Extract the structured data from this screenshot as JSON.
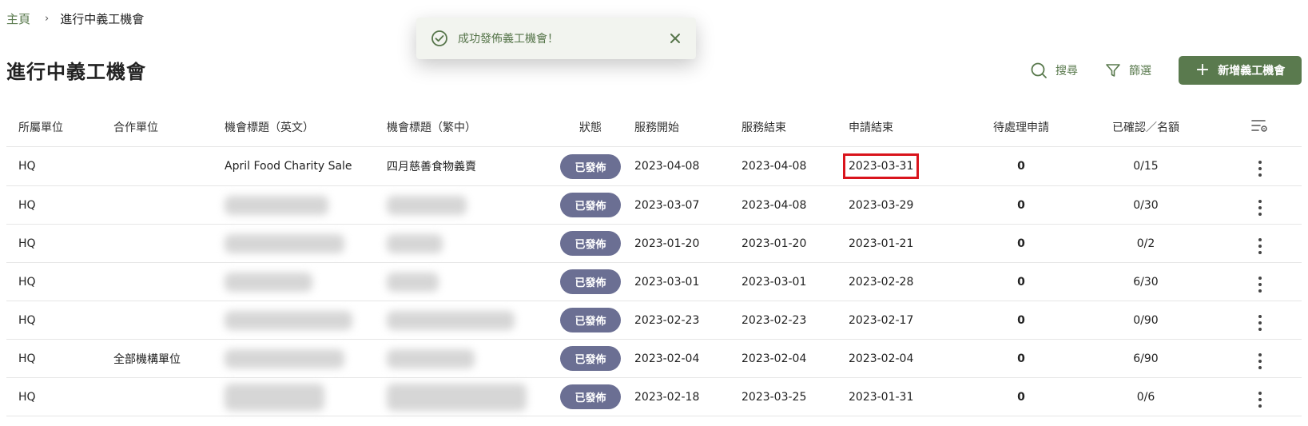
{
  "breadcrumb": {
    "home": "主頁",
    "separator": "›",
    "current": "進行中義工機會"
  },
  "page_title": "進行中義工機會",
  "toast": {
    "message": "成功發佈義工機會！",
    "icon": "check-circle-icon",
    "close_icon": "close-icon"
  },
  "actions": {
    "search_label": "搜尋",
    "filter_label": "篩選",
    "add_label": "新增義工機會",
    "add_symbol": "+"
  },
  "colors": {
    "brand_green": "#5a7a4e",
    "badge": "#6b6f93",
    "highlight": "#d9141c",
    "toast_bg": "#f2f4ef"
  },
  "table": {
    "headers": [
      "所屬單位",
      "合作單位",
      "機會標題（英文）",
      "機會標題（繁中）",
      "狀態",
      "服務開始",
      "服務結束",
      "申請結束",
      "待處理申請",
      "已確認／名額"
    ],
    "rows": [
      {
        "unit": "HQ",
        "partner": "",
        "title_en": "April Food Charity Sale",
        "title_zh": "四月慈善食物義賣",
        "status": "已發佈",
        "start": "2023-04-08",
        "end": "2023-04-08",
        "apply_end": "2023-03-31",
        "pending": "0",
        "confirmed": "0/15"
      },
      {
        "unit": "HQ",
        "partner": "",
        "title_en": "",
        "title_zh": "",
        "status": "已發佈",
        "start": "2023-03-07",
        "end": "2023-04-08",
        "apply_end": "2023-03-29",
        "pending": "0",
        "confirmed": "0/30"
      },
      {
        "unit": "HQ",
        "partner": "",
        "title_en": "",
        "title_zh": "",
        "status": "已發佈",
        "start": "2023-01-20",
        "end": "2023-01-20",
        "apply_end": "2023-01-21",
        "pending": "0",
        "confirmed": "0/2"
      },
      {
        "unit": "HQ",
        "partner": "",
        "title_en": "",
        "title_zh": "",
        "status": "已發佈",
        "start": "2023-03-01",
        "end": "2023-03-01",
        "apply_end": "2023-02-28",
        "pending": "0",
        "confirmed": "6/30"
      },
      {
        "unit": "HQ",
        "partner": "",
        "title_en": "",
        "title_zh": "",
        "status": "已發佈",
        "start": "2023-02-23",
        "end": "2023-02-23",
        "apply_end": "2023-02-17",
        "pending": "0",
        "confirmed": "0/90"
      },
      {
        "unit": "HQ",
        "partner": "全部機構單位",
        "title_en": "",
        "title_zh": "",
        "status": "已發佈",
        "start": "2023-02-04",
        "end": "2023-02-04",
        "apply_end": "2023-02-04",
        "pending": "0",
        "confirmed": "6/90"
      },
      {
        "unit": "HQ",
        "partner": "",
        "title_en": "",
        "title_zh": "",
        "status": "已發佈",
        "start": "2023-02-18",
        "end": "2023-03-25",
        "apply_end": "2023-01-31",
        "pending": "0",
        "confirmed": "0/6"
      }
    ]
  }
}
